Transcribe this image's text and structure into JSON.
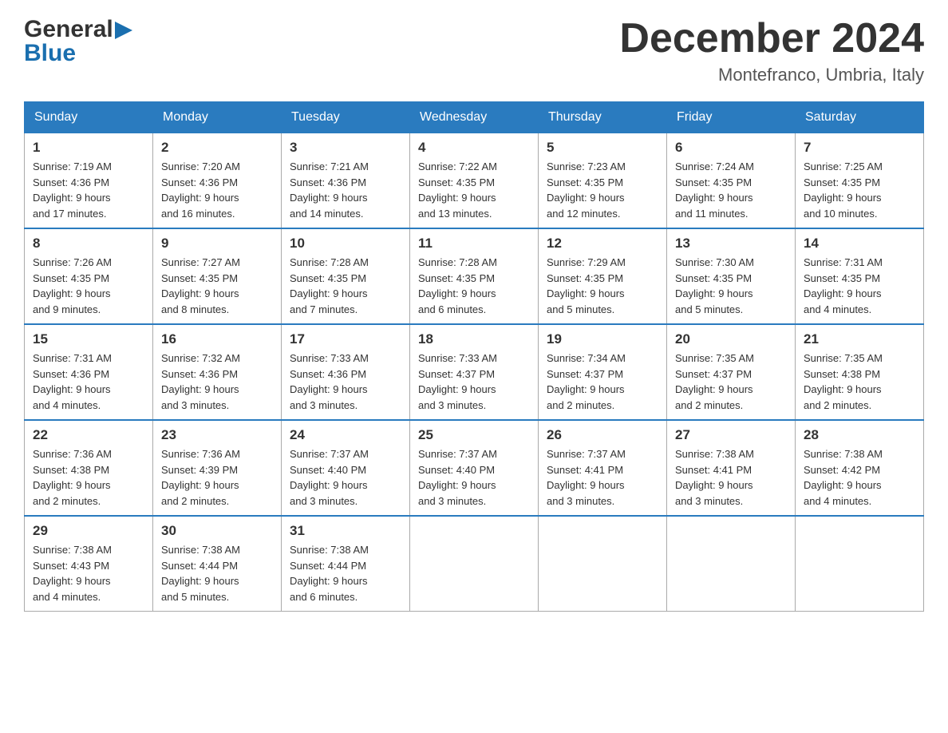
{
  "header": {
    "logo_general": "General",
    "logo_blue": "Blue",
    "month_title": "December 2024",
    "location": "Montefranco, Umbria, Italy"
  },
  "days_of_week": [
    "Sunday",
    "Monday",
    "Tuesday",
    "Wednesday",
    "Thursday",
    "Friday",
    "Saturday"
  ],
  "weeks": [
    [
      {
        "day": "1",
        "sunrise": "7:19 AM",
        "sunset": "4:36 PM",
        "daylight": "9 hours and 17 minutes."
      },
      {
        "day": "2",
        "sunrise": "7:20 AM",
        "sunset": "4:36 PM",
        "daylight": "9 hours and 16 minutes."
      },
      {
        "day": "3",
        "sunrise": "7:21 AM",
        "sunset": "4:36 PM",
        "daylight": "9 hours and 14 minutes."
      },
      {
        "day": "4",
        "sunrise": "7:22 AM",
        "sunset": "4:35 PM",
        "daylight": "9 hours and 13 minutes."
      },
      {
        "day": "5",
        "sunrise": "7:23 AM",
        "sunset": "4:35 PM",
        "daylight": "9 hours and 12 minutes."
      },
      {
        "day": "6",
        "sunrise": "7:24 AM",
        "sunset": "4:35 PM",
        "daylight": "9 hours and 11 minutes."
      },
      {
        "day": "7",
        "sunrise": "7:25 AM",
        "sunset": "4:35 PM",
        "daylight": "9 hours and 10 minutes."
      }
    ],
    [
      {
        "day": "8",
        "sunrise": "7:26 AM",
        "sunset": "4:35 PM",
        "daylight": "9 hours and 9 minutes."
      },
      {
        "day": "9",
        "sunrise": "7:27 AM",
        "sunset": "4:35 PM",
        "daylight": "9 hours and 8 minutes."
      },
      {
        "day": "10",
        "sunrise": "7:28 AM",
        "sunset": "4:35 PM",
        "daylight": "9 hours and 7 minutes."
      },
      {
        "day": "11",
        "sunrise": "7:28 AM",
        "sunset": "4:35 PM",
        "daylight": "9 hours and 6 minutes."
      },
      {
        "day": "12",
        "sunrise": "7:29 AM",
        "sunset": "4:35 PM",
        "daylight": "9 hours and 5 minutes."
      },
      {
        "day": "13",
        "sunrise": "7:30 AM",
        "sunset": "4:35 PM",
        "daylight": "9 hours and 5 minutes."
      },
      {
        "day": "14",
        "sunrise": "7:31 AM",
        "sunset": "4:35 PM",
        "daylight": "9 hours and 4 minutes."
      }
    ],
    [
      {
        "day": "15",
        "sunrise": "7:31 AM",
        "sunset": "4:36 PM",
        "daylight": "9 hours and 4 minutes."
      },
      {
        "day": "16",
        "sunrise": "7:32 AM",
        "sunset": "4:36 PM",
        "daylight": "9 hours and 3 minutes."
      },
      {
        "day": "17",
        "sunrise": "7:33 AM",
        "sunset": "4:36 PM",
        "daylight": "9 hours and 3 minutes."
      },
      {
        "day": "18",
        "sunrise": "7:33 AM",
        "sunset": "4:37 PM",
        "daylight": "9 hours and 3 minutes."
      },
      {
        "day": "19",
        "sunrise": "7:34 AM",
        "sunset": "4:37 PM",
        "daylight": "9 hours and 2 minutes."
      },
      {
        "day": "20",
        "sunrise": "7:35 AM",
        "sunset": "4:37 PM",
        "daylight": "9 hours and 2 minutes."
      },
      {
        "day": "21",
        "sunrise": "7:35 AM",
        "sunset": "4:38 PM",
        "daylight": "9 hours and 2 minutes."
      }
    ],
    [
      {
        "day": "22",
        "sunrise": "7:36 AM",
        "sunset": "4:38 PM",
        "daylight": "9 hours and 2 minutes."
      },
      {
        "day": "23",
        "sunrise": "7:36 AM",
        "sunset": "4:39 PM",
        "daylight": "9 hours and 2 minutes."
      },
      {
        "day": "24",
        "sunrise": "7:37 AM",
        "sunset": "4:40 PM",
        "daylight": "9 hours and 3 minutes."
      },
      {
        "day": "25",
        "sunrise": "7:37 AM",
        "sunset": "4:40 PM",
        "daylight": "9 hours and 3 minutes."
      },
      {
        "day": "26",
        "sunrise": "7:37 AM",
        "sunset": "4:41 PM",
        "daylight": "9 hours and 3 minutes."
      },
      {
        "day": "27",
        "sunrise": "7:38 AM",
        "sunset": "4:41 PM",
        "daylight": "9 hours and 3 minutes."
      },
      {
        "day": "28",
        "sunrise": "7:38 AM",
        "sunset": "4:42 PM",
        "daylight": "9 hours and 4 minutes."
      }
    ],
    [
      {
        "day": "29",
        "sunrise": "7:38 AM",
        "sunset": "4:43 PM",
        "daylight": "9 hours and 4 minutes."
      },
      {
        "day": "30",
        "sunrise": "7:38 AM",
        "sunset": "4:44 PM",
        "daylight": "9 hours and 5 minutes."
      },
      {
        "day": "31",
        "sunrise": "7:38 AM",
        "sunset": "4:44 PM",
        "daylight": "9 hours and 6 minutes."
      },
      null,
      null,
      null,
      null
    ]
  ],
  "labels": {
    "sunrise": "Sunrise:",
    "sunset": "Sunset:",
    "daylight": "Daylight:"
  }
}
